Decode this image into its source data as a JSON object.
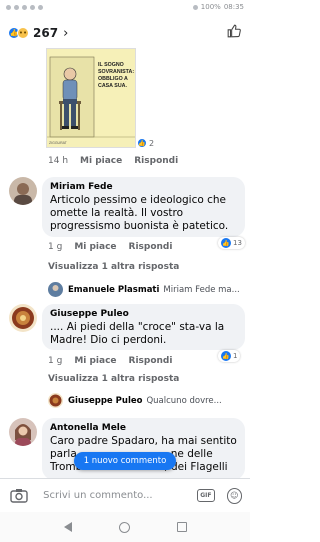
{
  "status": {
    "battery": "100%",
    "time": "08:35"
  },
  "header": {
    "reaction_count": "267"
  },
  "image_post": {
    "caption": [
      "IL SOGNO",
      "SOVRANISTA:",
      "OBBLIGO A",
      "CASA SUA."
    ],
    "signature": "ZIGGURAT",
    "reaction_count": "2"
  },
  "first_meta": {
    "time": "14 h",
    "like_label": "Mi piace",
    "reply_label": "Rispondi"
  },
  "comments": [
    {
      "author": "Miriam Fede",
      "text": "Articolo pessimo e ideologico che omette la realtà. Il vostro progressismo buonista  è patetico.",
      "time": "1 g",
      "like_label": "Mi piace",
      "reply_label": "Rispondi",
      "reaction_count": "13",
      "view_replies": "Visualizza 1 altra risposta",
      "reply_author": "Emanuele Plasmati",
      "reply_preview": "Miriam Fede ma..."
    },
    {
      "author": "Giuseppe Puleo",
      "text": "....  Ai piedi della \"croce\" sta-va la Madre! Dio ci perdoni.",
      "time": "1 g",
      "like_label": "Mi piace",
      "reply_label": "Rispondi",
      "reaction_count": "1",
      "view_replies": "Visualizza 1 altra risposta",
      "reply_author": "Giuseppe Puleo",
      "reply_preview": "Qualcuno dovre..."
    },
    {
      "author": "Antonella Mele",
      "text_line1": "Caro padre Spadaro, ha mai sentito",
      "text_line2_start": "parla",
      "text_line2_end": "ne delle",
      "text_line3_start": "Tromb",
      "text_line3_end": ", dei Flagelli"
    }
  ],
  "toast": "1 nuovo commento",
  "composer": {
    "placeholder": "Scrivi un commento...",
    "gif_label": "GIF"
  }
}
